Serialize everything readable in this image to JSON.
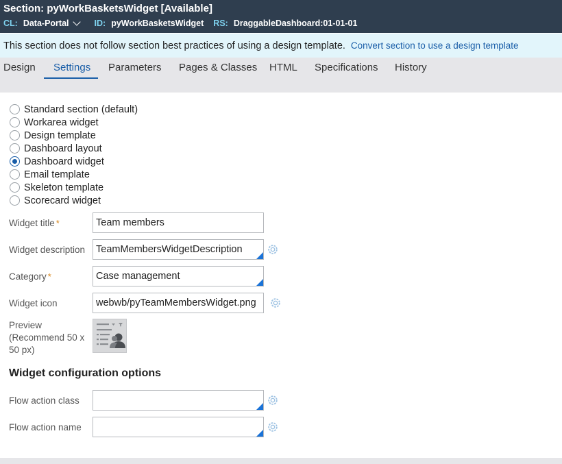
{
  "header": {
    "title": "Section: pyWorkBasketsWidget [Available]",
    "cl_key": "CL:",
    "cl_value": "Data-Portal",
    "id_key": "ID:",
    "id_value": "pyWorkBasketsWidget",
    "rs_key": "RS:",
    "rs_value": "DraggableDashboard:01-01-01"
  },
  "banner": {
    "message": "This section does not follow section best practices of using a design template.",
    "link": "Convert section to use a design template"
  },
  "tabs": [
    {
      "label": "Design"
    },
    {
      "label": "Settings"
    },
    {
      "label": "Parameters"
    },
    {
      "label": "Pages & Classes"
    },
    {
      "label": "HTML"
    },
    {
      "label": "Specifications"
    },
    {
      "label": "History"
    }
  ],
  "active_tab": "Settings",
  "section_types": [
    {
      "label": "Standard section (default)",
      "checked": false
    },
    {
      "label": "Workarea widget",
      "checked": false
    },
    {
      "label": "Design template",
      "checked": false
    },
    {
      "label": "Dashboard layout",
      "checked": false
    },
    {
      "label": "Dashboard widget",
      "checked": true
    },
    {
      "label": "Email template",
      "checked": false
    },
    {
      "label": "Skeleton template",
      "checked": false
    },
    {
      "label": "Scorecard widget",
      "checked": false
    }
  ],
  "fields": {
    "widget_title": {
      "label": "Widget title",
      "required_mark": "*",
      "value": "Team members"
    },
    "widget_description": {
      "label": "Widget description",
      "value": "TeamMembersWidgetDescription"
    },
    "category": {
      "label": "Category",
      "required_mark": "*",
      "value": "Case management"
    },
    "widget_icon": {
      "label": "Widget icon",
      "value": "webwb/pyTeamMembersWidget.png"
    },
    "preview": {
      "label": "Preview (Recommend 50 x 50 px)"
    }
  },
  "config": {
    "heading": "Widget configuration options",
    "flow_action_class": {
      "label": "Flow action class",
      "value": ""
    },
    "flow_action_name": {
      "label": "Flow action name",
      "value": ""
    }
  },
  "colors": {
    "header_bg": "#2f3e4f",
    "meta_key": "#7fd3f0",
    "accent": "#1a5ea8",
    "banner_bg": "#e2f5fb",
    "required": "#d8861d"
  },
  "icons": {
    "gear": "gear-icon",
    "chevron": "chevron-down-icon",
    "preview": "team-members-widget-icon"
  }
}
